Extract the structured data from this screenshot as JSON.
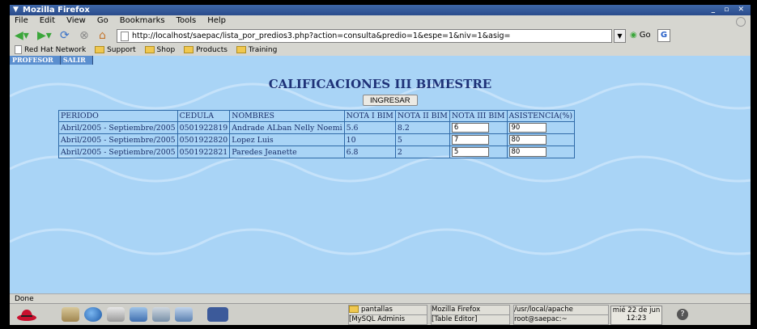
{
  "window": {
    "title": "Mozilla Firefox",
    "controls": "_ ▫ ✕"
  },
  "menu": [
    "File",
    "Edit",
    "View",
    "Go",
    "Bookmarks",
    "Tools",
    "Help"
  ],
  "nav": {
    "url": "http://localhost/saepac/lista_por_predios3.php?action=consulta&predio=1&espe=1&niv=1&asig=",
    "go_label": "Go",
    "search_glyph": "G"
  },
  "bookmarks": [
    "Red Hat Network",
    "Support",
    "Shop",
    "Products",
    "Training"
  ],
  "page": {
    "top_nav": [
      "PROFESOR",
      "SALIR"
    ],
    "title": "CALIFICACIONES III BIMESTRE",
    "submit_label": "INGRESAR",
    "columns": [
      "PERIODO",
      "CEDULA",
      "NOMBRES",
      "NOTA I BIM",
      "NOTA II BIM",
      "NOTA III BIM",
      "ASISTENCIA(%)"
    ],
    "rows": [
      {
        "periodo": "Abril/2005 - Septiembre/2005",
        "cedula": "0501922819",
        "nombres": "Andrade ALban Nelly Noemi",
        "nota1": "5.6",
        "nota2": "8.2",
        "nota3": "6",
        "asistencia": "90"
      },
      {
        "periodo": "Abril/2005 - Septiembre/2005",
        "cedula": "0501922820",
        "nombres": "Lopez Luis",
        "nota1": "10",
        "nota2": "5",
        "nota3": "7",
        "asistencia": "80"
      },
      {
        "periodo": "Abril/2005 - Septiembre/2005",
        "cedula": "0501922821",
        "nombres": "Paredes Jeanette",
        "nota1": "6.8",
        "nota2": "2",
        "nota3": "5",
        "asistencia": "80"
      }
    ]
  },
  "status": "Done",
  "taskbar": {
    "tasks": [
      "pantallas",
      "Mozilla Firefox",
      "/usr/local/apache",
      "[MySQL Adminis",
      "[Table Editor]",
      "root@saepac:~"
    ],
    "clock_date": "mié 22 de jun",
    "clock_time": "12:23"
  }
}
